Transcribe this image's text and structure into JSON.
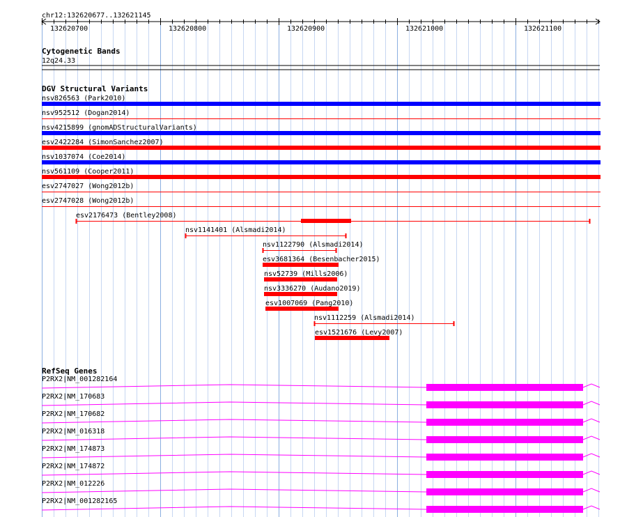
{
  "locus": "chr12:132620677..132621145",
  "ruler": {
    "ticks": [
      "132620700",
      "132620800",
      "132620900",
      "132621000",
      "132621100"
    ]
  },
  "tracks": {
    "cytoband": {
      "title": "Cytogenetic Bands",
      "band": "12q24.33"
    },
    "dgv": {
      "title": "DGV Structural Variants",
      "features": [
        {
          "label": "nsv826563 (Park2010)",
          "color": "#0000ff",
          "style": "thick",
          "span": "full"
        },
        {
          "label": "nsv952512 (Dogan2014)",
          "color": "#ff0000",
          "style": "thin",
          "span": "full"
        },
        {
          "label": "nsv4215899 (gnomADStructuralVariants)",
          "color": "#0000ff",
          "style": "thick",
          "span": "full"
        },
        {
          "label": "esv2422284 (SimonSanchez2007)",
          "color": "#ff0000",
          "style": "thick",
          "span": "full"
        },
        {
          "label": "nsv1037074 (Coe2014)",
          "color": "#0000ff",
          "style": "thick",
          "span": "full"
        },
        {
          "label": "nsv561109 (Cooper2011)",
          "color": "#ff0000",
          "style": "thick",
          "span": "full"
        },
        {
          "label": "esv2747027 (Wong2012b)",
          "color": "#ff0000",
          "style": "thin",
          "span": "full"
        },
        {
          "label": "esv2747028 (Wong2012b)",
          "color": "#ff0000",
          "style": "thin",
          "span": "full"
        },
        {
          "label": "esv2176473 (Bentley2008)",
          "color": "#ff0000",
          "style": "interval"
        },
        {
          "label": "nsv1141401 (Alsmadi2014)",
          "color": "#ff0000",
          "style": "interval"
        },
        {
          "label": "nsv1122790 (Alsmadi2014)",
          "color": "#ff0000",
          "style": "interval"
        },
        {
          "label": "esv3681364 (Besenbacher2015)",
          "color": "#ff0000",
          "style": "thick"
        },
        {
          "label": "nsv52739 (Mills2006)",
          "color": "#ff0000",
          "style": "thick"
        },
        {
          "label": "nsv3336270 (Audano2019)",
          "color": "#ff0000",
          "style": "thick"
        },
        {
          "label": "esv1007069 (Pang2010)",
          "color": "#ff0000",
          "style": "thick"
        },
        {
          "label": "nsv1112259 (Alsmadi2014)",
          "color": "#ff0000",
          "style": "interval"
        },
        {
          "label": "esv1521676 (Levy2007)",
          "color": "#ff0000",
          "style": "thick"
        }
      ]
    },
    "refseq": {
      "title": "RefSeq Genes",
      "color": "#ff00ff",
      "genes": [
        {
          "label": "P2RX2|NM_001282164"
        },
        {
          "label": "P2RX2|NM_170683"
        },
        {
          "label": "P2RX2|NM_170682"
        },
        {
          "label": "P2RX2|NM_016318"
        },
        {
          "label": "P2RX2|NM_174873"
        },
        {
          "label": "P2RX2|NM_174872"
        },
        {
          "label": "P2RX2|NM_012226"
        },
        {
          "label": "P2RX2|NM_001282165"
        }
      ]
    }
  }
}
